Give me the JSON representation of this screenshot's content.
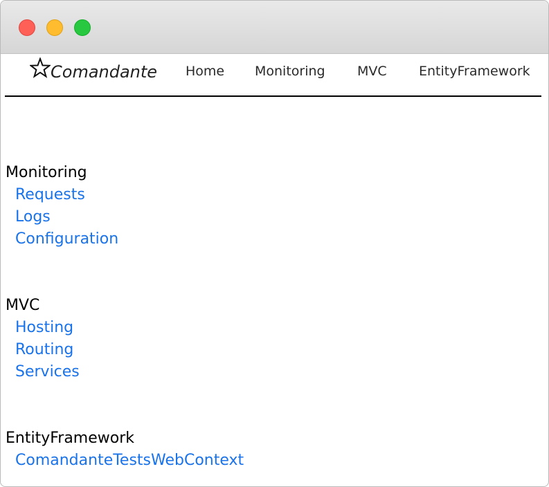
{
  "brand": {
    "name": "Comandante",
    "icon": "star-outline-icon"
  },
  "nav": {
    "home": "Home",
    "monitoring": "Monitoring",
    "mvc": "MVC",
    "entity_framework": "EntityFramework"
  },
  "sections": [
    {
      "title": "Monitoring",
      "links": [
        "Requests",
        "Logs",
        "Configuration"
      ]
    },
    {
      "title": "MVC",
      "links": [
        "Hosting",
        "Routing",
        "Services"
      ]
    },
    {
      "title": "EntityFramework",
      "links": [
        "ComandanteTestsWebContext"
      ]
    }
  ],
  "colors": {
    "link": "#1a73e8",
    "close": "#fe5f57",
    "minimize": "#febc2e",
    "maximize": "#28c840"
  }
}
